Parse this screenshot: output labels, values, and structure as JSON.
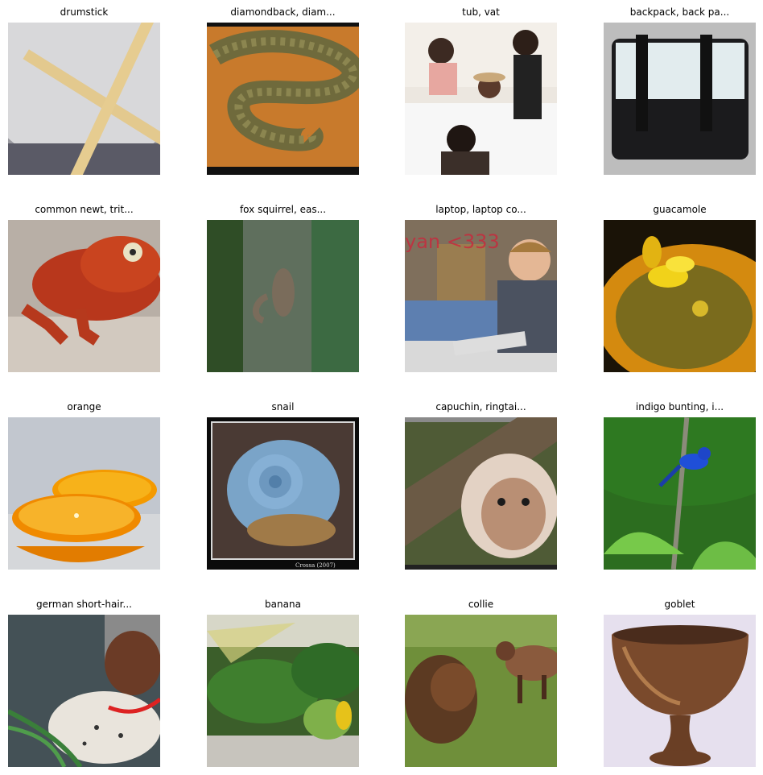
{
  "grid": {
    "items": [
      {
        "label": "drumstick",
        "subject": "drumstick"
      },
      {
        "label": "diamondback, diam...",
        "subject": "diamondback"
      },
      {
        "label": "tub, vat",
        "subject": "tub"
      },
      {
        "label": "backpack, back pa...",
        "subject": "backpack"
      },
      {
        "label": "common newt, trit...",
        "subject": "newt"
      },
      {
        "label": "fox squirrel, eas...",
        "subject": "squirrel"
      },
      {
        "label": "laptop, laptop co...",
        "subject": "laptop",
        "overlay_text": "yan <333"
      },
      {
        "label": "guacamole",
        "subject": "guacamole"
      },
      {
        "label": "orange",
        "subject": "orange"
      },
      {
        "label": "snail",
        "subject": "snail",
        "watermark": "Crossa (2007)"
      },
      {
        "label": "capuchin, ringtai...",
        "subject": "capuchin"
      },
      {
        "label": "indigo bunting, i...",
        "subject": "bunting"
      },
      {
        "label": "german short-hair...",
        "subject": "dog"
      },
      {
        "label": "banana",
        "subject": "banana"
      },
      {
        "label": "collie",
        "subject": "collie"
      },
      {
        "label": "goblet",
        "subject": "goblet"
      }
    ]
  }
}
